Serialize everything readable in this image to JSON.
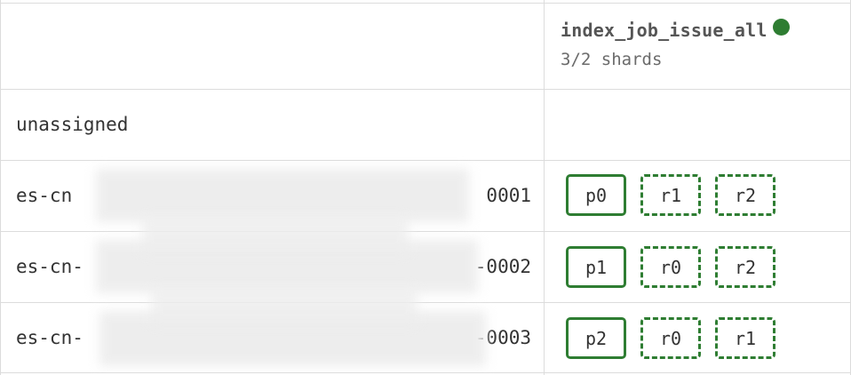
{
  "index": {
    "name": "index_job_issue_all",
    "shards_summary": "3/2 shards",
    "health_color": "#2e7d32"
  },
  "rows": [
    {
      "label": "unassigned",
      "shards": []
    },
    {
      "node_prefix": "es-cn",
      "node_suffix": "0001",
      "shards": [
        {
          "label": "p0",
          "kind": "primary"
        },
        {
          "label": "r1",
          "kind": "replica"
        },
        {
          "label": "r2",
          "kind": "replica"
        }
      ]
    },
    {
      "node_prefix": "es-cn-",
      "node_suffix": "-0002",
      "shards": [
        {
          "label": "p1",
          "kind": "primary"
        },
        {
          "label": "r0",
          "kind": "replica"
        },
        {
          "label": "r2",
          "kind": "replica"
        }
      ]
    },
    {
      "node_prefix": "es-cn-",
      "node_suffix": "-0003",
      "shards": [
        {
          "label": "p2",
          "kind": "primary"
        },
        {
          "label": "r0",
          "kind": "replica"
        },
        {
          "label": "r1",
          "kind": "replica"
        }
      ]
    }
  ]
}
